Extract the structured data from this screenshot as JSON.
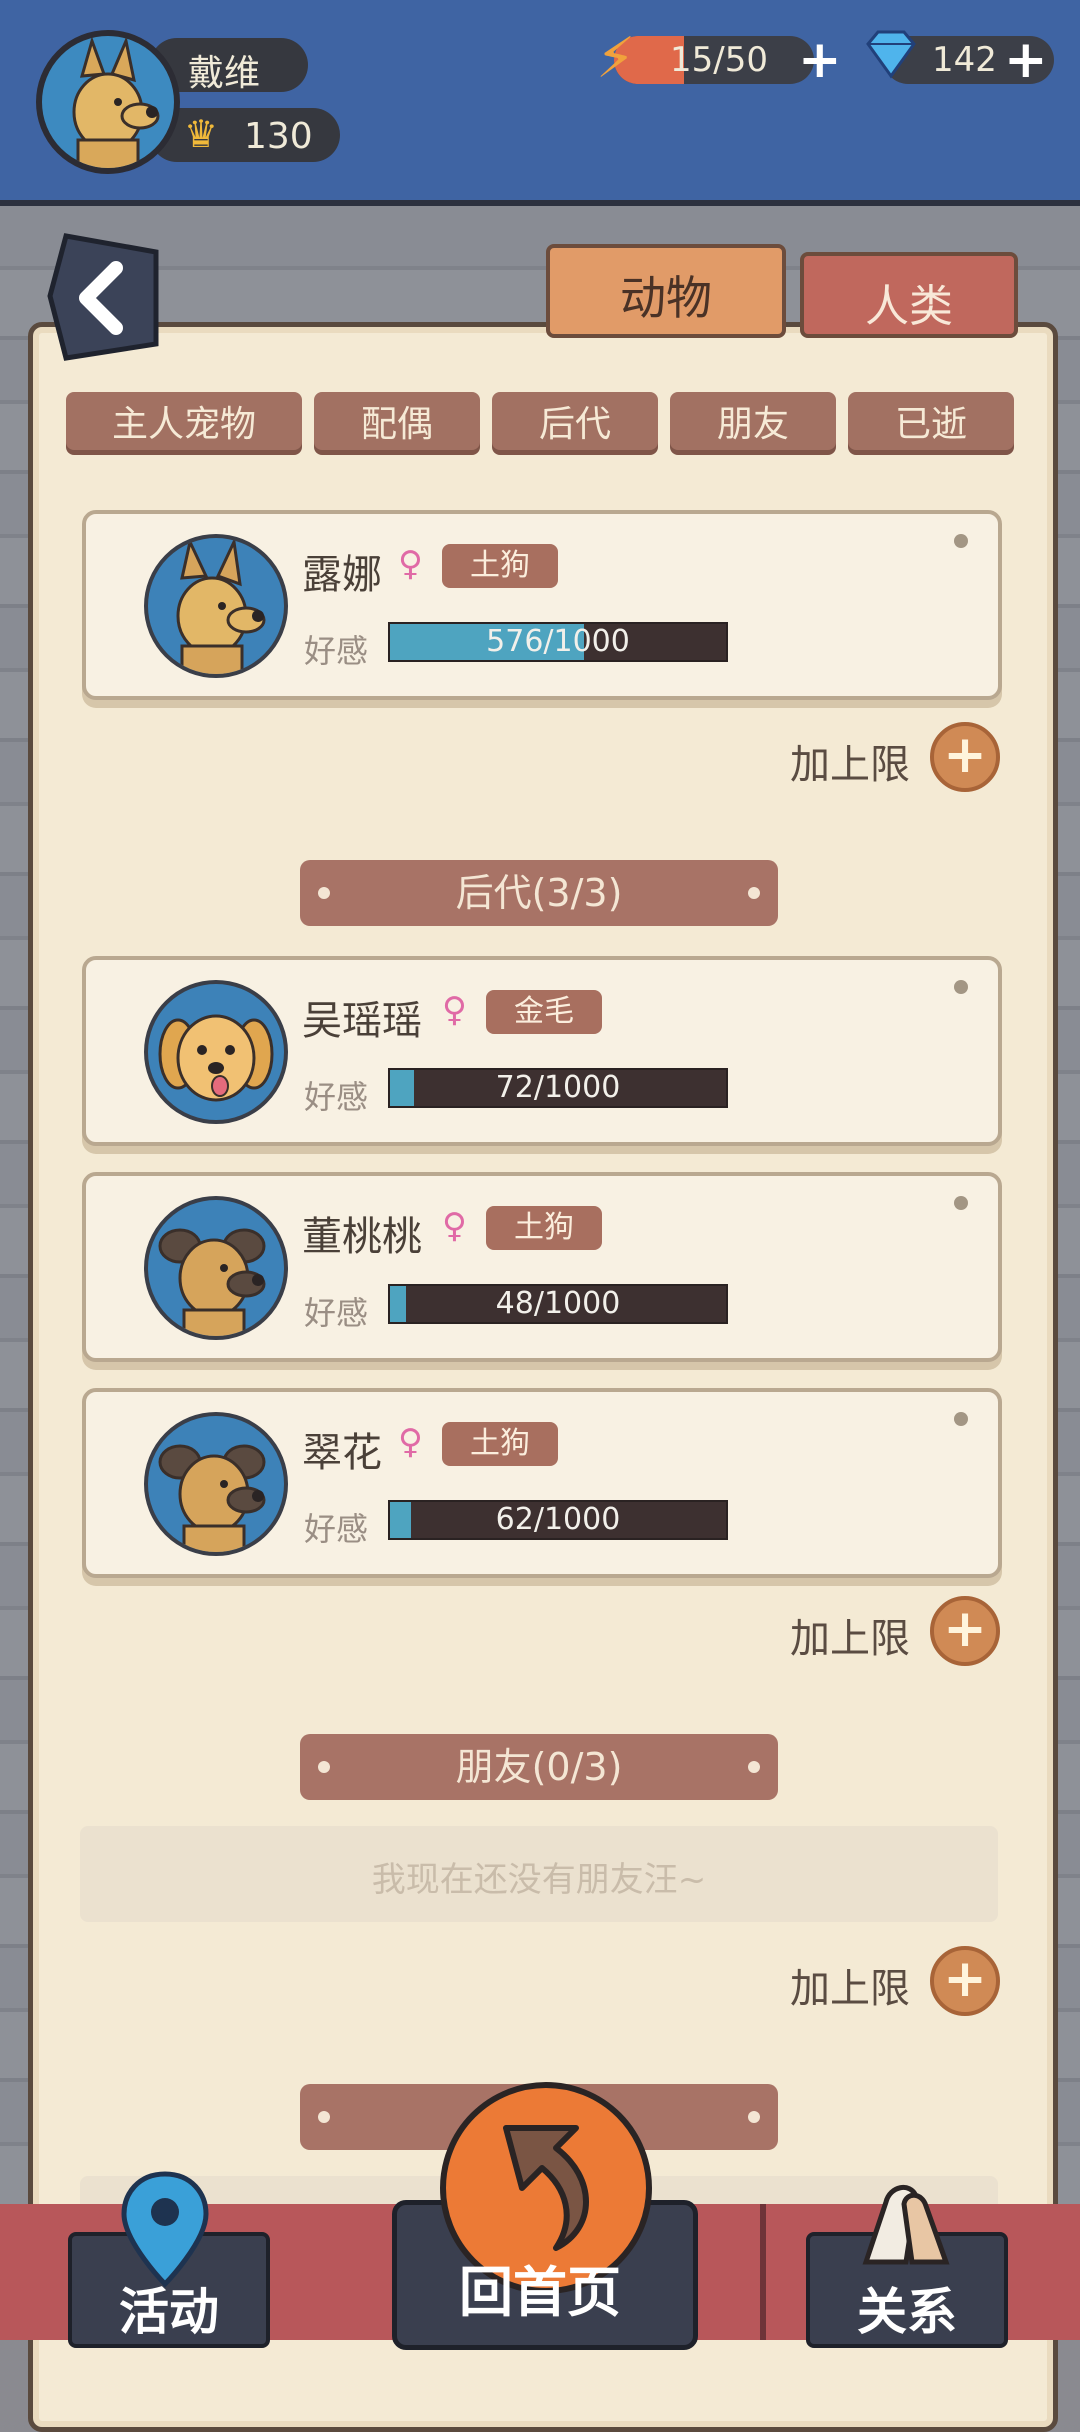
{
  "player": {
    "name": "戴维",
    "crown": "130",
    "avatar_icon": "shepherd-dog"
  },
  "resources": {
    "energy": "15/50",
    "gems": "142",
    "energy_color": "#f19d3b",
    "gem_color": "#4fb4ec"
  },
  "top_tabs": {
    "animals": "动物",
    "humans": "人类"
  },
  "sub_tabs": [
    "主人宠物",
    "配偶",
    "后代",
    "朋友",
    "已逝"
  ],
  "spouse": {
    "name": "露娜",
    "gender": "♀",
    "breed": "土狗",
    "fav_label": "好感",
    "fav_text": "576/1000",
    "fav_value": 576,
    "fav_max": 1000
  },
  "add_limit_label": "加上限",
  "offspring_header": "后代(3/3)",
  "offspring": [
    {
      "name": "吴瑶瑶",
      "gender": "♀",
      "breed": "金毛",
      "fav_label": "好感",
      "fav_text": "72/1000",
      "fav_value": 72
    },
    {
      "name": "董桃桃",
      "gender": "♀",
      "breed": "土狗",
      "fav_label": "好感",
      "fav_text": "48/1000",
      "fav_value": 48
    },
    {
      "name": "翠花",
      "gender": "♀",
      "breed": "土狗",
      "fav_label": "好感",
      "fav_text": "62/1000",
      "fav_value": 62
    }
  ],
  "friends_header": "朋友(0/3)",
  "friends_empty": "我现在还没有朋友汪~",
  "bottom_nav": {
    "activity": "活动",
    "home": "回首页",
    "relations": "关系"
  }
}
